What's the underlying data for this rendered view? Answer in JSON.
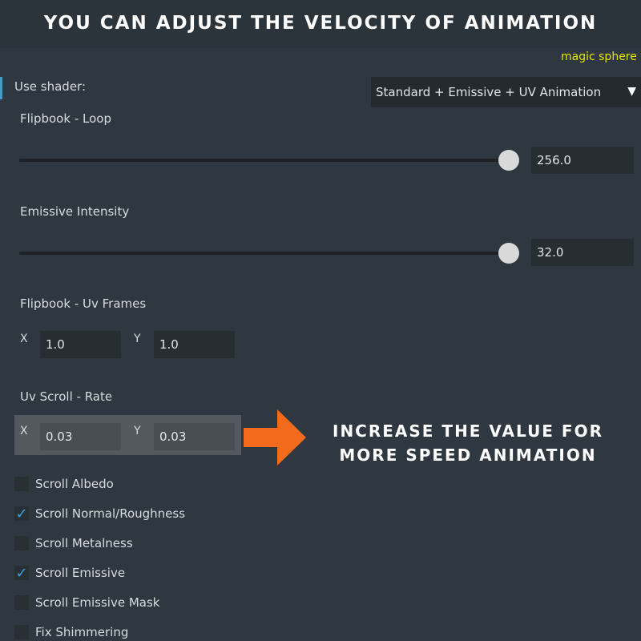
{
  "banner": {
    "title": "You can adjust the velocity of animation"
  },
  "material": {
    "name": "magic sphere"
  },
  "shader": {
    "label": "Use shader:",
    "selected": "Standard + Emissive + UV Animation",
    "arrow_icon": "triangle-down-icon"
  },
  "flipbook_loop": {
    "label": "Flipbook - Loop",
    "value": "256.0",
    "slider_fraction": 1.0
  },
  "emissive_intensity": {
    "label": "Emissive Intensity",
    "value": "32.0",
    "slider_fraction": 1.0
  },
  "uv_frames": {
    "label": "Flipbook - Uv Frames",
    "x_label": "X",
    "x_value": "1.0",
    "y_label": "Y",
    "y_value": "1.0"
  },
  "uv_scroll": {
    "label": "Uv Scroll - Rate",
    "x_label": "X",
    "x_value": "0.03",
    "y_label": "Y",
    "y_value": "0.03"
  },
  "callout": {
    "text": "Increase the value for more speed animation",
    "arrow_color": "#f26b1d"
  },
  "checkboxes": [
    {
      "label": "Scroll Albedo",
      "checked": false
    },
    {
      "label": "Scroll Normal/Roughness",
      "checked": true
    },
    {
      "label": "Scroll Metalness",
      "checked": false
    },
    {
      "label": "Scroll Emissive",
      "checked": true
    },
    {
      "label": "Scroll Emissive Mask",
      "checked": false
    },
    {
      "label": "Fix Shimmering",
      "checked": false
    }
  ],
  "check_mark": "✓",
  "colors": {
    "accent": "#3aa0e0",
    "background": "#2f3840",
    "highlight_text": "#e6e600",
    "arrow": "#f26b1d"
  }
}
